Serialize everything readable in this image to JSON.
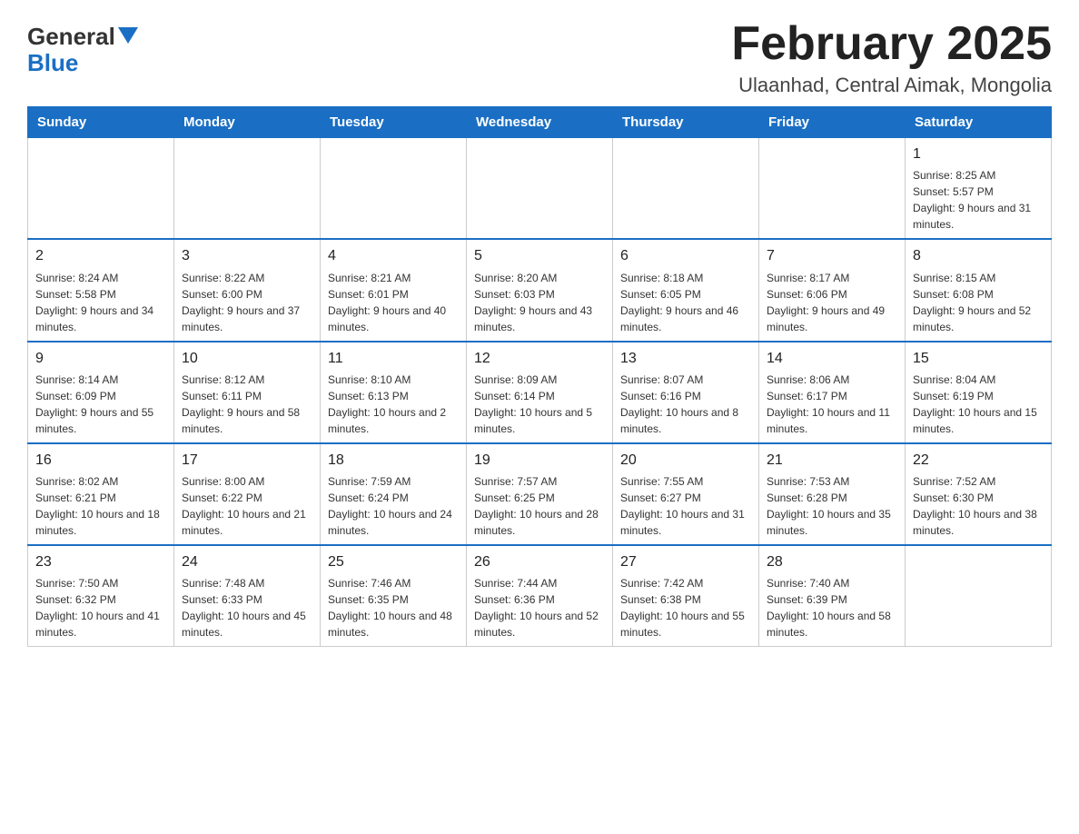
{
  "header": {
    "logo_general": "General",
    "logo_blue": "Blue",
    "month_title": "February 2025",
    "location": "Ulaanhad, Central Aimak, Mongolia"
  },
  "days_of_week": [
    "Sunday",
    "Monday",
    "Tuesday",
    "Wednesday",
    "Thursday",
    "Friday",
    "Saturday"
  ],
  "weeks": [
    [
      {
        "day": "",
        "info": ""
      },
      {
        "day": "",
        "info": ""
      },
      {
        "day": "",
        "info": ""
      },
      {
        "day": "",
        "info": ""
      },
      {
        "day": "",
        "info": ""
      },
      {
        "day": "",
        "info": ""
      },
      {
        "day": "1",
        "info": "Sunrise: 8:25 AM\nSunset: 5:57 PM\nDaylight: 9 hours and 31 minutes."
      }
    ],
    [
      {
        "day": "2",
        "info": "Sunrise: 8:24 AM\nSunset: 5:58 PM\nDaylight: 9 hours and 34 minutes."
      },
      {
        "day": "3",
        "info": "Sunrise: 8:22 AM\nSunset: 6:00 PM\nDaylight: 9 hours and 37 minutes."
      },
      {
        "day": "4",
        "info": "Sunrise: 8:21 AM\nSunset: 6:01 PM\nDaylight: 9 hours and 40 minutes."
      },
      {
        "day": "5",
        "info": "Sunrise: 8:20 AM\nSunset: 6:03 PM\nDaylight: 9 hours and 43 minutes."
      },
      {
        "day": "6",
        "info": "Sunrise: 8:18 AM\nSunset: 6:05 PM\nDaylight: 9 hours and 46 minutes."
      },
      {
        "day": "7",
        "info": "Sunrise: 8:17 AM\nSunset: 6:06 PM\nDaylight: 9 hours and 49 minutes."
      },
      {
        "day": "8",
        "info": "Sunrise: 8:15 AM\nSunset: 6:08 PM\nDaylight: 9 hours and 52 minutes."
      }
    ],
    [
      {
        "day": "9",
        "info": "Sunrise: 8:14 AM\nSunset: 6:09 PM\nDaylight: 9 hours and 55 minutes."
      },
      {
        "day": "10",
        "info": "Sunrise: 8:12 AM\nSunset: 6:11 PM\nDaylight: 9 hours and 58 minutes."
      },
      {
        "day": "11",
        "info": "Sunrise: 8:10 AM\nSunset: 6:13 PM\nDaylight: 10 hours and 2 minutes."
      },
      {
        "day": "12",
        "info": "Sunrise: 8:09 AM\nSunset: 6:14 PM\nDaylight: 10 hours and 5 minutes."
      },
      {
        "day": "13",
        "info": "Sunrise: 8:07 AM\nSunset: 6:16 PM\nDaylight: 10 hours and 8 minutes."
      },
      {
        "day": "14",
        "info": "Sunrise: 8:06 AM\nSunset: 6:17 PM\nDaylight: 10 hours and 11 minutes."
      },
      {
        "day": "15",
        "info": "Sunrise: 8:04 AM\nSunset: 6:19 PM\nDaylight: 10 hours and 15 minutes."
      }
    ],
    [
      {
        "day": "16",
        "info": "Sunrise: 8:02 AM\nSunset: 6:21 PM\nDaylight: 10 hours and 18 minutes."
      },
      {
        "day": "17",
        "info": "Sunrise: 8:00 AM\nSunset: 6:22 PM\nDaylight: 10 hours and 21 minutes."
      },
      {
        "day": "18",
        "info": "Sunrise: 7:59 AM\nSunset: 6:24 PM\nDaylight: 10 hours and 24 minutes."
      },
      {
        "day": "19",
        "info": "Sunrise: 7:57 AM\nSunset: 6:25 PM\nDaylight: 10 hours and 28 minutes."
      },
      {
        "day": "20",
        "info": "Sunrise: 7:55 AM\nSunset: 6:27 PM\nDaylight: 10 hours and 31 minutes."
      },
      {
        "day": "21",
        "info": "Sunrise: 7:53 AM\nSunset: 6:28 PM\nDaylight: 10 hours and 35 minutes."
      },
      {
        "day": "22",
        "info": "Sunrise: 7:52 AM\nSunset: 6:30 PM\nDaylight: 10 hours and 38 minutes."
      }
    ],
    [
      {
        "day": "23",
        "info": "Sunrise: 7:50 AM\nSunset: 6:32 PM\nDaylight: 10 hours and 41 minutes."
      },
      {
        "day": "24",
        "info": "Sunrise: 7:48 AM\nSunset: 6:33 PM\nDaylight: 10 hours and 45 minutes."
      },
      {
        "day": "25",
        "info": "Sunrise: 7:46 AM\nSunset: 6:35 PM\nDaylight: 10 hours and 48 minutes."
      },
      {
        "day": "26",
        "info": "Sunrise: 7:44 AM\nSunset: 6:36 PM\nDaylight: 10 hours and 52 minutes."
      },
      {
        "day": "27",
        "info": "Sunrise: 7:42 AM\nSunset: 6:38 PM\nDaylight: 10 hours and 55 minutes."
      },
      {
        "day": "28",
        "info": "Sunrise: 7:40 AM\nSunset: 6:39 PM\nDaylight: 10 hours and 58 minutes."
      },
      {
        "day": "",
        "info": ""
      }
    ]
  ]
}
